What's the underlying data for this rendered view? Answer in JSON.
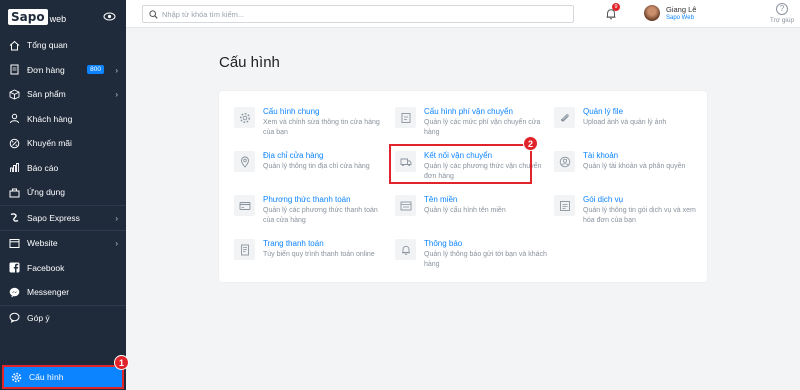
{
  "sidebar": {
    "logo_main": "Sapo",
    "logo_sub": "web",
    "items": [
      {
        "label": "Tổng quan",
        "icon": "home-icon"
      },
      {
        "label": "Đơn hàng",
        "icon": "order-icon",
        "badge": "800"
      },
      {
        "label": "Sản phẩm",
        "icon": "product-icon"
      },
      {
        "label": "Khách hàng",
        "icon": "customer-icon"
      },
      {
        "label": "Khuyến mãi",
        "icon": "promotion-icon"
      },
      {
        "label": "Báo cáo",
        "icon": "report-icon"
      },
      {
        "label": "Ứng dụng",
        "icon": "apps-icon"
      },
      {
        "label": "Sapo Express",
        "icon": "express-icon"
      },
      {
        "label": "Website",
        "icon": "website-icon"
      },
      {
        "label": "Facebook",
        "icon": "facebook-icon"
      },
      {
        "label": "Messenger",
        "icon": "messenger-icon"
      },
      {
        "label": "Góp ý",
        "icon": "feedback-icon"
      }
    ],
    "active_item": {
      "label": "Cấu hình",
      "icon": "gear-icon"
    }
  },
  "topbar": {
    "search_placeholder": "Nhập từ khóa tìm kiếm...",
    "notification_count": "9",
    "user_name": "Giang Lê",
    "user_store": "Sapo Web",
    "help_label": "Trợ giúp"
  },
  "steps": {
    "one": "1",
    "two": "2"
  },
  "main": {
    "title": "Cấu hình",
    "settings": [
      {
        "title": "Cấu hình chung",
        "desc": "Xem và chỉnh sửa thông tin cửa hàng của bạn",
        "icon": "gear-icon"
      },
      {
        "title": "Cấu hình phí vận chuyển",
        "desc": "Quản lý các mức phí vận chuyển cửa hàng",
        "icon": "shipping-fee-icon"
      },
      {
        "title": "Quản lý file",
        "desc": "Upload ảnh và quản lý ảnh",
        "icon": "paperclip-icon"
      },
      {
        "title": "Địa chỉ cửa hàng",
        "desc": "Quản lý thông tin địa chỉ cửa hàng",
        "icon": "location-icon"
      },
      {
        "title": "Kết nối vận chuyển",
        "desc": "Quản lý các phương thức vận chuyển đơn hàng",
        "icon": "truck-icon"
      },
      {
        "title": "Tài khoản",
        "desc": "Quản lý tài khoản và phân quyền",
        "icon": "account-icon"
      },
      {
        "title": "Phương thức thanh toán",
        "desc": "Quản lý các phương thức thanh toán của cửa hàng",
        "icon": "payment-icon"
      },
      {
        "title": "Tên miền",
        "desc": "Quản lý cấu hình tên miền",
        "icon": "domain-icon"
      },
      {
        "title": "Gói dịch vụ",
        "desc": "Quản lý thông tin gói dịch vụ và xem hóa đơn của bạn",
        "icon": "service-plan-icon"
      },
      {
        "title": "Trang thanh toán",
        "desc": "Tùy biến quy trình thanh toán online",
        "icon": "checkout-icon"
      },
      {
        "title": "Thông báo",
        "desc": "Quản lý thông báo gửi tới bạn và khách hàng",
        "icon": "bell-icon"
      }
    ]
  },
  "colors": {
    "sidebar_bg": "#1f2a3b",
    "accent": "#0d84ff",
    "highlight": "#e0242a"
  }
}
